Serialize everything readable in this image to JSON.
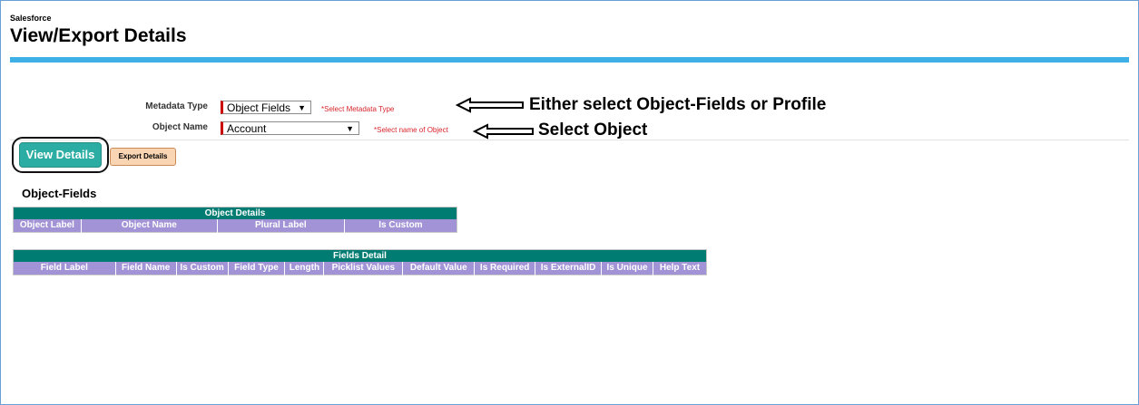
{
  "header": {
    "app_name": "Salesforce",
    "title": "View/Export Details"
  },
  "form": {
    "metadata_type": {
      "label": "Metadata Type",
      "value": "Object Fields",
      "hint": "*Select Metadata Type"
    },
    "object_name": {
      "label": "Object Name",
      "value": "Account",
      "hint": "*Select name of Object"
    }
  },
  "annotations": {
    "metadata_note": "Either select Object-Fields or Profile",
    "object_note": "Select Object"
  },
  "actions": {
    "view_details": "View Details",
    "export_details": "Export Details"
  },
  "section_title": "Object-Fields",
  "object_table": {
    "caption": "Object Details",
    "columns": [
      "Object Label",
      "Object Name",
      "Plural Label",
      "Is Custom"
    ]
  },
  "fields_table": {
    "caption": "Fields Detail",
    "columns": [
      "Field Label",
      "Field Name",
      "Is Custom",
      "Field Type",
      "Length",
      "Picklist Values",
      "Default Value",
      "Is Required",
      "Is ExternalID",
      "Is Unique",
      "Help Text"
    ]
  },
  "colors": {
    "accent_bar": "#3fb0e6",
    "table_caption": "#007c72",
    "table_header": "#a193d6",
    "view_button": "#2bada3",
    "export_button": "#f9d5b3",
    "hint": "#d8262c"
  }
}
